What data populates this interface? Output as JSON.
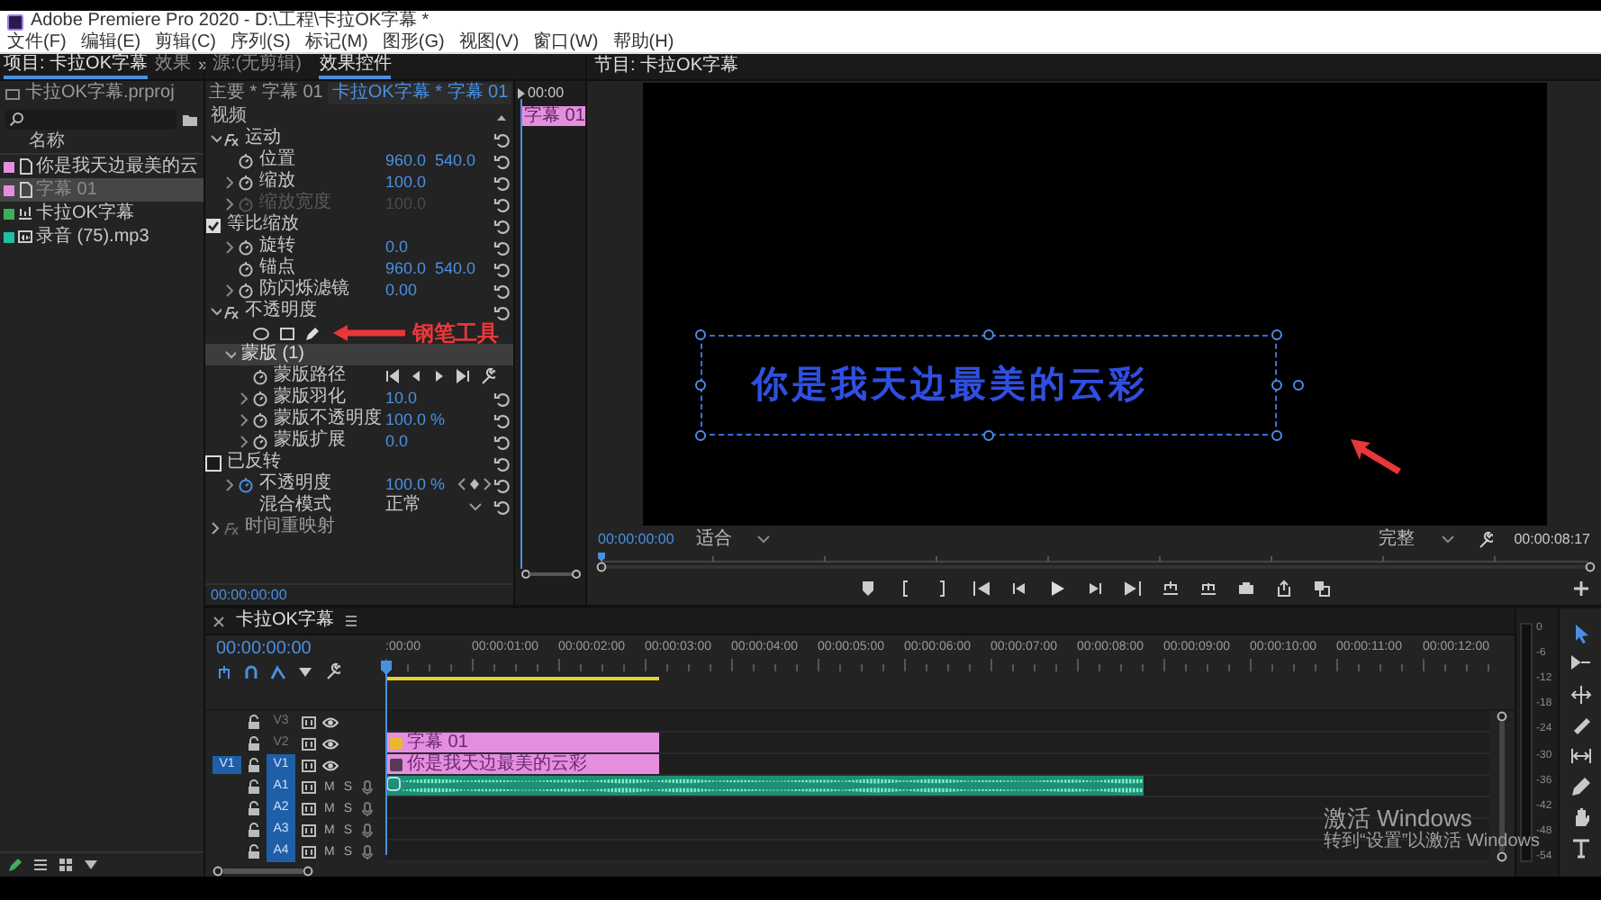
{
  "window": {
    "title": "Adobe Premiere Pro 2020 - D:\\工程\\卡拉OK字幕 *"
  },
  "menu": [
    "文件(F)",
    "编辑(E)",
    "剪辑(C)",
    "序列(S)",
    "标记(M)",
    "图形(G)",
    "视图(V)",
    "窗口(W)",
    "帮助(H)"
  ],
  "project_panel": {
    "tabs": [
      {
        "label": "项目: 卡拉OK字幕",
        "selected": true
      },
      {
        "label": "效果",
        "selected": false
      }
    ],
    "overflow": "»",
    "file": "卡拉OK字幕.prproj",
    "column": "名称",
    "items": [
      {
        "name": "你是我天边最美的云",
        "color": "#e58ee0",
        "kind": "graphic",
        "selected": false
      },
      {
        "name": "字幕 01",
        "color": "#e58ee0",
        "kind": "graphic",
        "selected": true
      },
      {
        "name": "卡拉OK字幕",
        "color": "#3fae5a",
        "kind": "sequence",
        "selected": false
      },
      {
        "name": "录音 (75).mp3",
        "color": "#1fbfa0",
        "kind": "audio",
        "selected": false
      }
    ]
  },
  "effect_controls": {
    "tabs": [
      {
        "label": "源:(无剪辑)",
        "selected": false
      },
      {
        "label": "效果控件",
        "selected": true
      }
    ],
    "master": "主要 * 字幕 01",
    "sequence_clip": "卡拉OK字幕 * 字幕 01",
    "section": "视频",
    "ruler_time": "00:00",
    "clip": "字幕 01",
    "timecode": "00:00:00:00",
    "rows": [
      {
        "kind": "group",
        "label": "运动",
        "expanded": true,
        "children": [
          {
            "kind": "property",
            "label": "位置",
            "values": [
              "960.0",
              "540.0"
            ],
            "expandable": false,
            "disabled": false,
            "animated": false
          },
          {
            "kind": "property",
            "label": "缩放",
            "values": [
              "100.0"
            ],
            "expandable": true,
            "disabled": false,
            "animated": false
          },
          {
            "kind": "property",
            "label": "缩放宽度",
            "values": [
              "100.0"
            ],
            "expandable": true,
            "disabled": true,
            "animated": false
          },
          {
            "kind": "checkbox",
            "label": "等比缩放",
            "checked": true
          },
          {
            "kind": "property",
            "label": "旋转",
            "values": [
              "0.0"
            ],
            "expandable": true,
            "disabled": false,
            "animated": false
          },
          {
            "kind": "property",
            "label": "锚点",
            "values": [
              "960.0",
              "540.0"
            ],
            "expandable": false,
            "disabled": false,
            "animated": false
          },
          {
            "kind": "property",
            "label": "防闪烁滤镜",
            "values": [
              "0.00"
            ],
            "expandable": true,
            "disabled": false,
            "animated": false
          }
        ]
      },
      {
        "kind": "group",
        "label": "不透明度",
        "expanded": true,
        "children": [
          {
            "kind": "mask_tools",
            "annotation": "钢笔工具"
          },
          {
            "kind": "mask",
            "label": "蒙版 (1)",
            "expanded": true,
            "selected": true,
            "children": [
              {
                "kind": "mask_path",
                "label": "蒙版路径"
              },
              {
                "kind": "property",
                "label": "蒙版羽化",
                "values": [
                  "10.0"
                ],
                "expandable": true,
                "disabled": false,
                "animated": false
              },
              {
                "kind": "property",
                "label": "蒙版不透明度",
                "values": [
                  "100.0 %"
                ],
                "expandable": true,
                "disabled": false,
                "animated": false
              },
              {
                "kind": "property",
                "label": "蒙版扩展",
                "values": [
                  "0.0"
                ],
                "expandable": true,
                "disabled": false,
                "animated": false
              },
              {
                "kind": "checkbox",
                "label": "已反转",
                "checked": false
              }
            ]
          },
          {
            "kind": "property",
            "label": "不透明度",
            "values": [
              "100.0 %"
            ],
            "expandable": true,
            "disabled": false,
            "animated": true
          },
          {
            "kind": "dropdown",
            "label": "混合模式",
            "value": "正常"
          }
        ]
      },
      {
        "kind": "group",
        "label": "时间重映射",
        "expanded": false
      }
    ]
  },
  "monitor": {
    "tab": "节目: 卡拉OK字幕",
    "caption": "你是我天边最美的云彩",
    "timecode": "00:00:00:00",
    "fit": "适合",
    "quality": "完整",
    "duration": "00:00:08:17"
  },
  "timeline": {
    "tab": "卡拉OK字幕",
    "timecode": "00:00:00:00",
    "work_area": {
      "level": 0.25
    },
    "ruler": [
      ":00:00",
      "00:00:01:00",
      "00:00:02:00",
      "00:00:03:00",
      "00:00:04:00",
      "00:00:05:00",
      "00:00:06:00",
      "00:00:07:00",
      "00:00:08:00",
      "00:00:09:00",
      "00:00:10:00",
      "00:00:11:00",
      "00:00:12:00"
    ],
    "tracks": [
      {
        "name": "V3",
        "kind": "video",
        "targeted": false
      },
      {
        "name": "V2",
        "kind": "video",
        "targeted": false,
        "clips": [
          {
            "kind": "graphic",
            "label": "字幕 01",
            "has_effects": true,
            "level": 0.25
          }
        ]
      },
      {
        "name": "V1",
        "kind": "video",
        "targeted": true,
        "source_patch": "V1",
        "clips": [
          {
            "kind": "graphic",
            "label": "你是我天边最美的云彩",
            "has_effects": false,
            "level": 0.25
          }
        ]
      },
      {
        "name": "A1",
        "kind": "audio",
        "targeted": true,
        "mute": "M",
        "solo": "S",
        "clips": [
          {
            "kind": "audio",
            "level": 0.69
          }
        ]
      },
      {
        "name": "A2",
        "kind": "audio",
        "targeted": true,
        "mute": "M",
        "solo": "S"
      },
      {
        "name": "A3",
        "kind": "audio",
        "targeted": true,
        "mute": "M",
        "solo": "S"
      },
      {
        "name": "A4",
        "kind": "audio",
        "targeted": true,
        "mute": "M",
        "solo": "S"
      }
    ]
  },
  "meter": {
    "scale": [
      "0",
      "-6",
      "-12",
      "-18",
      "-24",
      "-30",
      "-36",
      "-42",
      "-48",
      "-54"
    ]
  },
  "tools": [
    {
      "kind": "selection",
      "selected": true
    },
    {
      "kind": "track_select",
      "selected": false
    },
    {
      "kind": "ripple",
      "selected": false
    },
    {
      "kind": "razor",
      "selected": false
    },
    {
      "kind": "slip",
      "selected": false
    },
    {
      "kind": "pen",
      "selected": false
    },
    {
      "kind": "hand",
      "selected": false
    },
    {
      "kind": "type",
      "selected": false
    }
  ],
  "os_notice": {
    "title": "激活 Windows",
    "message": "转到“设置”以激活 Windows"
  }
}
